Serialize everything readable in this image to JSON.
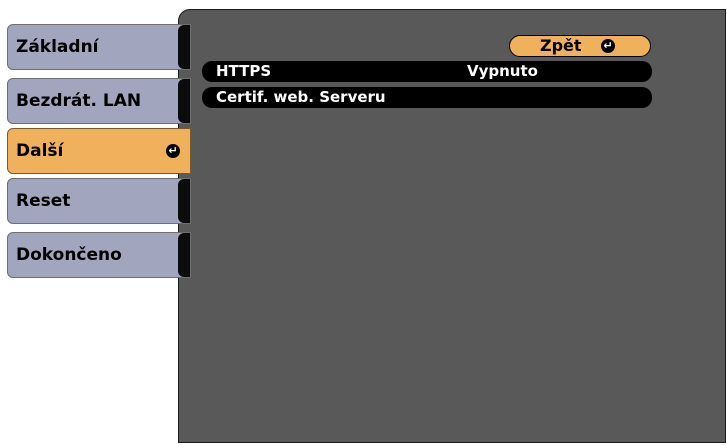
{
  "sidebar": {
    "items": [
      {
        "label": "Základní"
      },
      {
        "label": "Bezdrát. LAN"
      },
      {
        "label": "Další"
      },
      {
        "label": "Reset"
      },
      {
        "label": "Dokončeno"
      }
    ],
    "selected_index": 2
  },
  "main": {
    "back_label": "Zpět",
    "rows": [
      {
        "label": "HTTPS",
        "value": "Vypnuto"
      },
      {
        "label": "Certif. web. Serveru",
        "value": ""
      }
    ]
  },
  "colors": {
    "tab": "#a2a5be",
    "selected": "#f0b15c",
    "panel": "#595959",
    "row": "#000000"
  },
  "icons": {
    "enter": "enter-icon"
  }
}
